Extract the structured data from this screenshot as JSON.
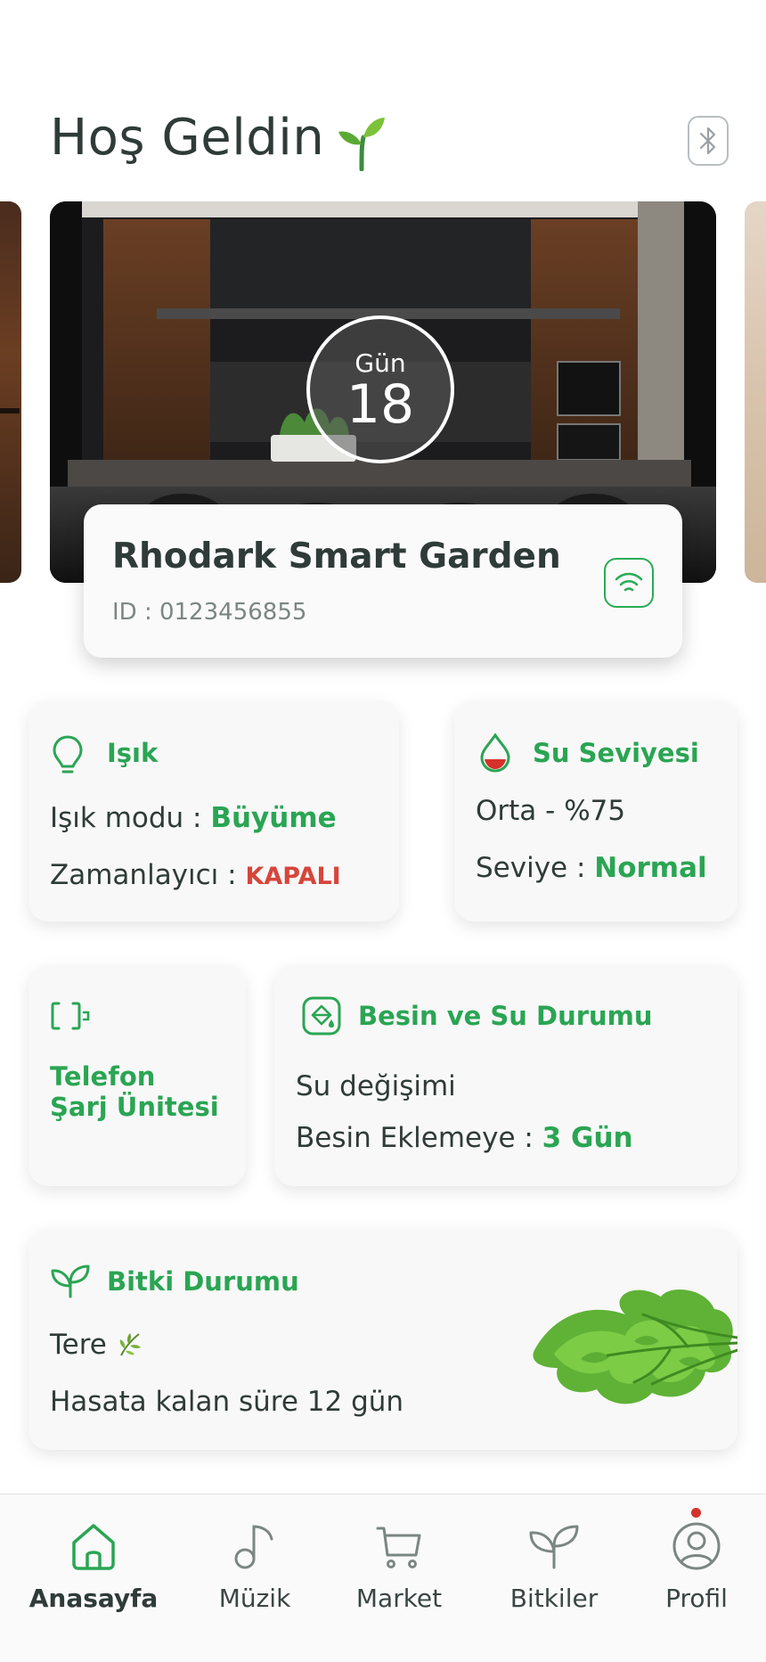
{
  "header": {
    "greeting": "Hoş Geldin",
    "sprout_icon": "sprout-icon",
    "bluetooth_icon": "bluetooth-icon"
  },
  "hero": {
    "day_label": "Gün",
    "day_number": "18"
  },
  "device": {
    "name": "Rhodark Smart Garden",
    "id_text": "ID : 0123456855",
    "wifi_icon": "wifi-icon"
  },
  "light": {
    "title": "Işık",
    "mode_label": "Işık modu : ",
    "mode_value": "Büyüme",
    "timer_label": "Zamanlayıcı : ",
    "timer_value": "KAPALI"
  },
  "water": {
    "title": "Su Seviyesi",
    "level_text": "Orta - %75",
    "level_label": "Seviye : ",
    "level_value": "Normal"
  },
  "phone": {
    "title_line1": "Telefon",
    "title_line2": "Şarj Ünitesi"
  },
  "nutrition": {
    "title": "Besin ve Su Durumu",
    "water_change": "Su değişimi",
    "add_label": "Besin Eklemeye : ",
    "add_value": "3 Gün"
  },
  "plant": {
    "title": "Bitki Durumu",
    "name": "Tere",
    "harvest_text": "Hasata kalan süre 12 gün"
  },
  "nav": {
    "home": "Anasayfa",
    "music": "Müzik",
    "market": "Market",
    "plants": "Bitkiler",
    "profile": "Profil"
  },
  "colors": {
    "accent_green": "#2aa553",
    "alert_red": "#d6453b",
    "text_dark": "#2f3b38"
  }
}
